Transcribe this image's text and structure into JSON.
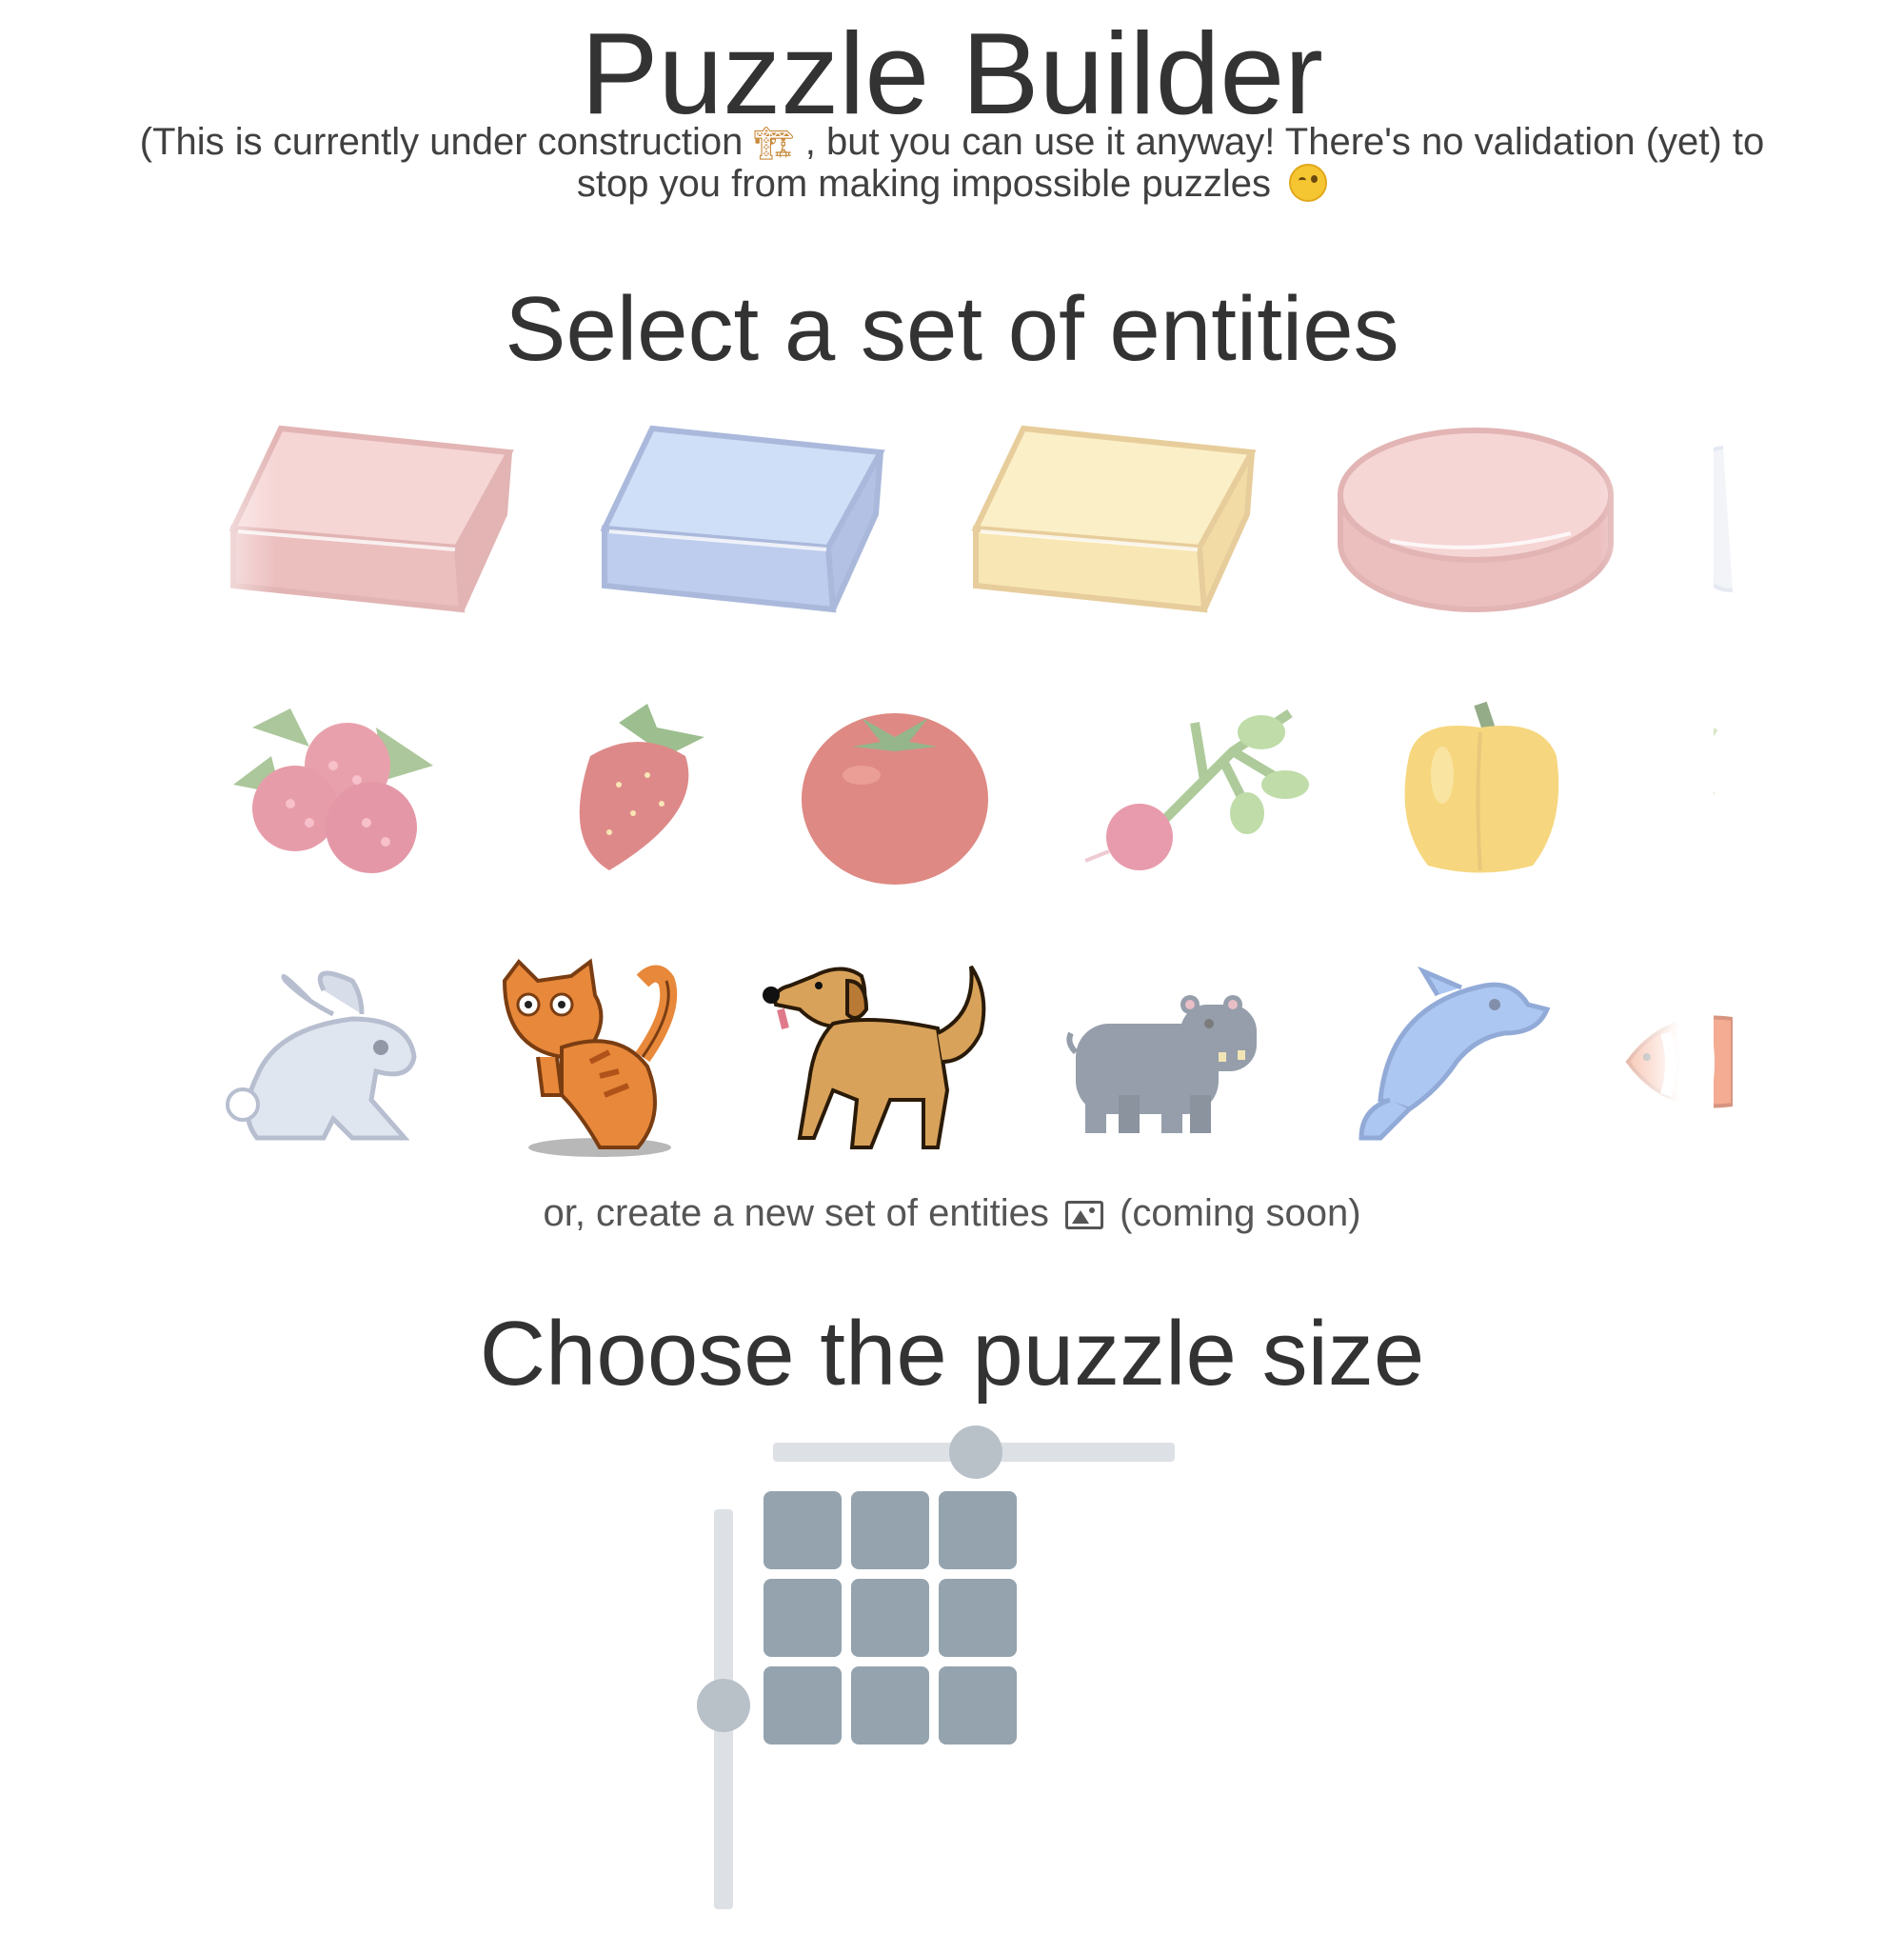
{
  "header": {
    "title": "Puzzle Builder",
    "subtitle_part1": "(This is currently under construction",
    "subtitle_part2": ", but you can use it anyway! There's no validation (yet) to stop you from making impossible puzzles"
  },
  "entities": {
    "title": "Select a set of entities",
    "rows": [
      {
        "name": "blocks",
        "items": [
          "red-block",
          "blue-block",
          "yellow-block",
          "red-disc"
        ]
      },
      {
        "name": "produce",
        "items": [
          "raspberries",
          "strawberry",
          "tomato",
          "radish",
          "yellow-pepper"
        ]
      },
      {
        "name": "animals",
        "items": [
          "rabbit",
          "cat",
          "dog",
          "hippo",
          "dolphin",
          "clownfish"
        ]
      }
    ],
    "create_text": "or, create a new set of entities",
    "create_suffix": "(coming soon)"
  },
  "size": {
    "title": "Choose the puzzle size",
    "columns": 3,
    "rows": 3
  },
  "colors": {
    "cell": "#94a3ae",
    "slider_track": "#dde1e5",
    "slider_thumb": "#b8c0c8"
  }
}
